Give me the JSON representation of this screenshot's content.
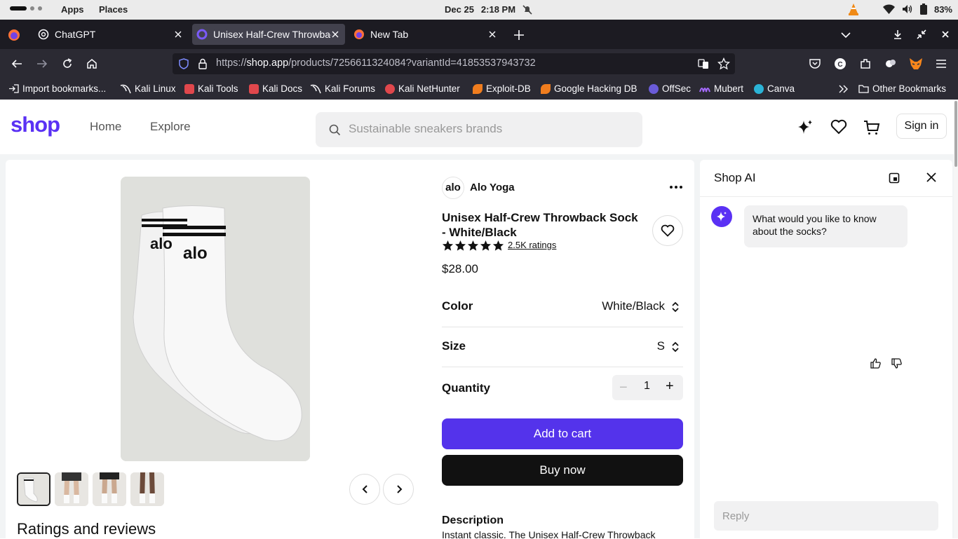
{
  "topbar": {
    "apps": "Apps",
    "places": "Places",
    "date": "Dec 25",
    "time": "2:18 PM",
    "battery": "83%"
  },
  "tabs": [
    {
      "title": "ChatGPT",
      "active": false
    },
    {
      "title": "Unisex Half-Crew Throwback",
      "active": true
    },
    {
      "title": "New Tab",
      "active": false
    }
  ],
  "url": {
    "prefix": "https://",
    "domain": "shop.app",
    "path": "/products/7256611324084?variantId=41853537943732"
  },
  "bookmarks": [
    {
      "label": "Import bookmarks...",
      "color": "#cfcfd8"
    },
    {
      "label": "Kali Linux",
      "color": "#3b8fd9"
    },
    {
      "label": "Kali Tools",
      "color": "#e0474c"
    },
    {
      "label": "Kali Docs",
      "color": "#e0474c"
    },
    {
      "label": "Kali Forums",
      "color": "#3b8fd9"
    },
    {
      "label": "Kali NetHunter",
      "color": "#e0474c"
    },
    {
      "label": "Exploit-DB",
      "color": "#f07d1e"
    },
    {
      "label": "Google Hacking DB",
      "color": "#f07d1e"
    },
    {
      "label": "OffSec",
      "color": "#6a5bd8"
    },
    {
      "label": "Mubert",
      "color": "#8a4de8"
    },
    {
      "label": "Canva",
      "color": "#2bb3d6"
    }
  ],
  "bookmarks_other": "Other Bookmarks",
  "shop": {
    "logo": "shop",
    "nav": [
      "Home",
      "Explore"
    ],
    "search_placeholder": "Sustainable sneakers brands",
    "signin": "Sign in",
    "accent": "#5a31f4"
  },
  "product": {
    "brand_logo": "alo",
    "brand": "Alo Yoga",
    "title": "Unisex Half-Crew Throwback Sock - White/Black",
    "rating_stars": 5,
    "ratings_label": "2.5K ratings",
    "price": "$28.00",
    "options": [
      {
        "label": "Color",
        "value": "White/Black"
      },
      {
        "label": "Size",
        "value": "S"
      }
    ],
    "quantity_label": "Quantity",
    "quantity": "1",
    "add_to_cart": "Add to cart",
    "buy_now": "Buy now",
    "description_heading": "Description",
    "description": "Instant classic. The Unisex Half-Crew Throwback",
    "sock_text": "alo",
    "ratings_heading": "Ratings and reviews"
  },
  "ai_panel": {
    "title": "Shop AI",
    "message": "What would you like to know about the socks?",
    "reply_placeholder": "Reply"
  }
}
